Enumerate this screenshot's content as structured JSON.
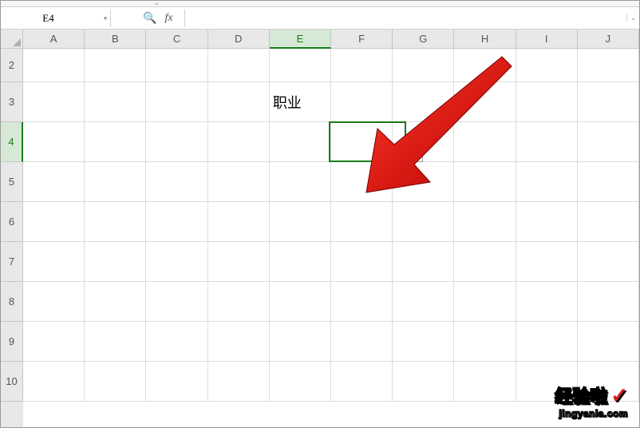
{
  "name_box": {
    "value": "E4"
  },
  "formula_bar": {
    "fx_label": "fx",
    "value": ""
  },
  "columns": [
    "A",
    "B",
    "C",
    "D",
    "E",
    "F",
    "G",
    "H",
    "I",
    "J"
  ],
  "rows": [
    2,
    3,
    4,
    5,
    6,
    7,
    8,
    9,
    10
  ],
  "active_cell": {
    "ref": "E4",
    "col_index": 4,
    "row_label": 4
  },
  "cells": {
    "E3": "职业"
  },
  "annotation_arrow": {
    "color": "#d62020"
  },
  "watermark": {
    "text": "经验啦",
    "check": "✓",
    "url": "jingyanla.com"
  }
}
